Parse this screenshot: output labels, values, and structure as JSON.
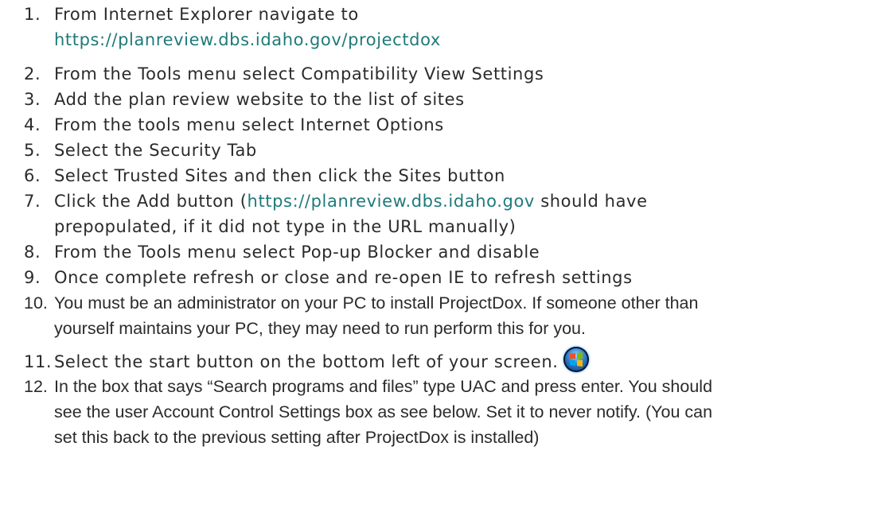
{
  "instructions": [
    {
      "num": "1.",
      "text": "From Internet Explorer navigate to",
      "link": "https://planreview.dbs.idaho.gov/projectdox"
    },
    {
      "num": "2.",
      "text": "From the Tools menu select Compatibility View Settings"
    },
    {
      "num": "3.",
      "text": "Add the plan review website to the list of sites"
    },
    {
      "num": "4.",
      "text": "From the tools menu select Internet Options"
    },
    {
      "num": "5.",
      "text": "Select the Security Tab"
    },
    {
      "num": "6.",
      "text": "Select Trusted Sites and then click the Sites button"
    },
    {
      "num": "7.",
      "text_before": "Click the Add button (",
      "link": "https://planreview.dbs.idaho.gov",
      "text_after": " should have",
      "line2": "prepopulated, if it did not type in the URL manually)"
    },
    {
      "num": "8.",
      "text": "From the Tools menu select Pop-up Blocker and disable"
    },
    {
      "num": "9.",
      "text": "Once complete refresh or close and re-open IE to refresh settings"
    },
    {
      "num": "10.",
      "line1": "You must be an administrator on your PC to install ProjectDox.  If someone other than",
      "line2": "yourself maintains your PC, they may need to run perform this for you."
    },
    {
      "num": "11.",
      "text": "Select the start button on the bottom left of your screen."
    },
    {
      "num": "12.",
      "line1": "In the box that says “Search programs and files” type UAC and press enter.  You should",
      "line2": "see the user Account Control Settings box as see below.  Set it to never notify.  (You can",
      "line3": "set this back to the previous setting after ProjectDox is installed)"
    }
  ],
  "icons": {
    "start_button": "windows-start-orb-icon"
  },
  "colors": {
    "text": "#2b2b2b",
    "link": "#1f7a7a"
  }
}
